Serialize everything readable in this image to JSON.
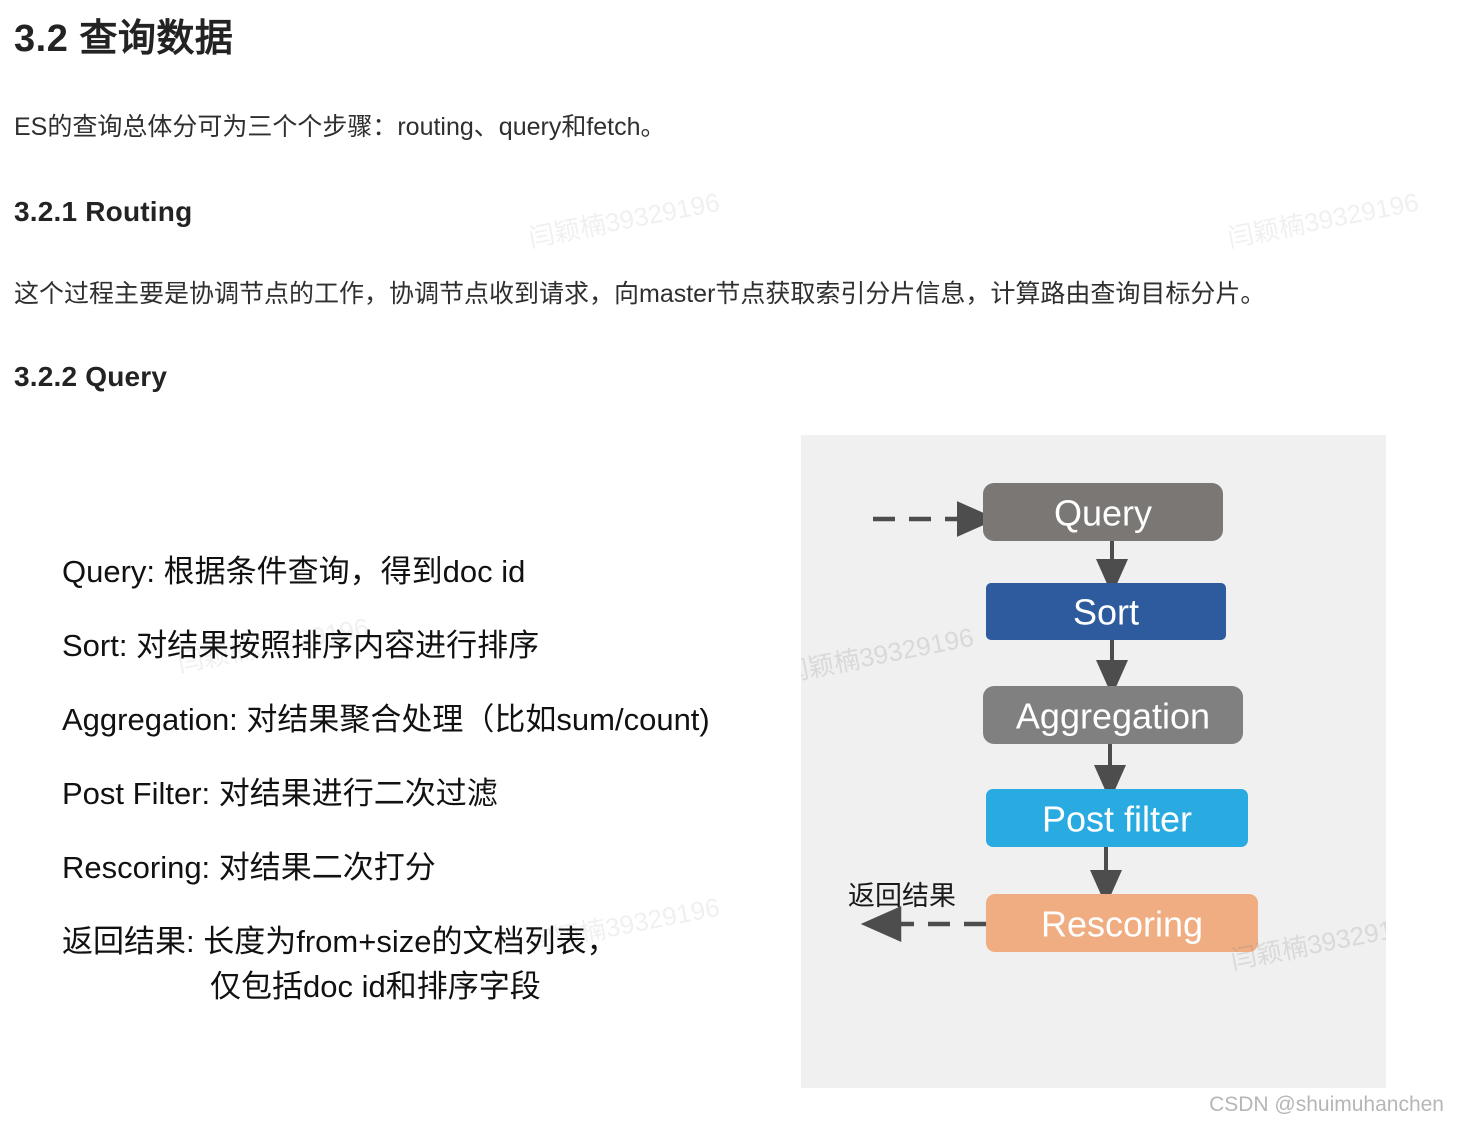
{
  "document": {
    "title": "3.2 查询数据",
    "intro": "ES的查询总体分可为三个个步骤：routing、query和fetch。",
    "section_routing": {
      "heading": "3.2.1 Routing",
      "body": "这个过程主要是协调节点的工作，协调节点收到请求，向master节点获取索引分片信息，计算路由查询目标分片。"
    },
    "section_query": {
      "heading": "3.2.2 Query"
    }
  },
  "steps": [
    {
      "label": "Query:",
      "desc": "根据条件查询，得到doc id",
      "full": "Query:  根据条件查询，得到doc id"
    },
    {
      "label": "Sort:",
      "desc": "对结果按照排序内容进行排序",
      "full": "Sort: 对结果按照排序内容进行排序"
    },
    {
      "label": "Aggregation:",
      "desc": "对结果聚合处理（比如sum/count)",
      "full": "Aggregation: 对结果聚合处理（比如sum/count)"
    },
    {
      "label": "Post Filter:",
      "desc": "对结果进行二次过滤",
      "full": "Post Filter: 对结果进行二次过滤"
    },
    {
      "label": "Rescoring:",
      "desc": "对结果二次打分",
      "full": "Rescoring: 对结果二次打分"
    },
    {
      "label": "返回结果:",
      "desc": "长度为from+size的文档列表，",
      "full": "返回结果: 长度为from+size的文档列表，",
      "continuation": "仅包括doc id和排序字段"
    }
  ],
  "diagram": {
    "background": "#f0f0f0",
    "entry_arrow": "dashed-arrow-right",
    "return_label": "返回结果",
    "return_arrow": "dashed-arrow-left",
    "nodes": [
      {
        "id": "query",
        "label": "Query",
        "color": "#7b7774"
      },
      {
        "id": "sort",
        "label": "Sort",
        "color": "#2e5b9e"
      },
      {
        "id": "aggregation",
        "label": "Aggregation",
        "color": "#808080"
      },
      {
        "id": "post-filter",
        "label": "Post filter",
        "color": "#29abe2"
      },
      {
        "id": "rescoring",
        "label": "Rescoring",
        "color": "#f0ad82"
      }
    ],
    "connectors": [
      {
        "from": "query",
        "to": "sort",
        "style": "solid-arrow-down"
      },
      {
        "from": "sort",
        "to": "aggregation",
        "style": "solid-arrow-down"
      },
      {
        "from": "aggregation",
        "to": "post-filter",
        "style": "solid-arrow-down"
      },
      {
        "from": "post-filter",
        "to": "rescoring",
        "style": "solid-arrow-down"
      }
    ]
  },
  "watermark": {
    "text": "闫颖楠39329196"
  },
  "footer": {
    "credit": "CSDN @shuimuhanchen"
  }
}
